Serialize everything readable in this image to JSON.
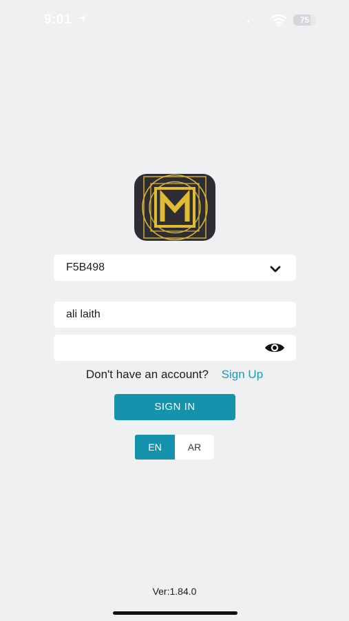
{
  "status_bar": {
    "time": "9:01",
    "battery": "75",
    "battery_level": 0.75,
    "icons": [
      "location-icon",
      "signal-dot",
      "wifi-icon",
      "battery-icon"
    ]
  },
  "logo": {
    "icon": "m-monogram-logo",
    "colors": {
      "background": "#2d2d33",
      "accent": "#d9b437"
    }
  },
  "form": {
    "company_select": {
      "value": "F5B498",
      "icon": "chevron-down-icon"
    },
    "username": {
      "value": "ali laith"
    },
    "password": {
      "value": "",
      "icon": "eye-icon"
    }
  },
  "signup": {
    "question": "Don't have an account?",
    "link": "Sign Up"
  },
  "signin_button": {
    "label": "SIGN IN"
  },
  "language": {
    "options": [
      "EN",
      "AR"
    ],
    "selected": "EN"
  },
  "version": "Ver:1.84.0",
  "colors": {
    "primary": "#1592ac",
    "link": "#1e9bb3",
    "background": "#eef0f2"
  }
}
